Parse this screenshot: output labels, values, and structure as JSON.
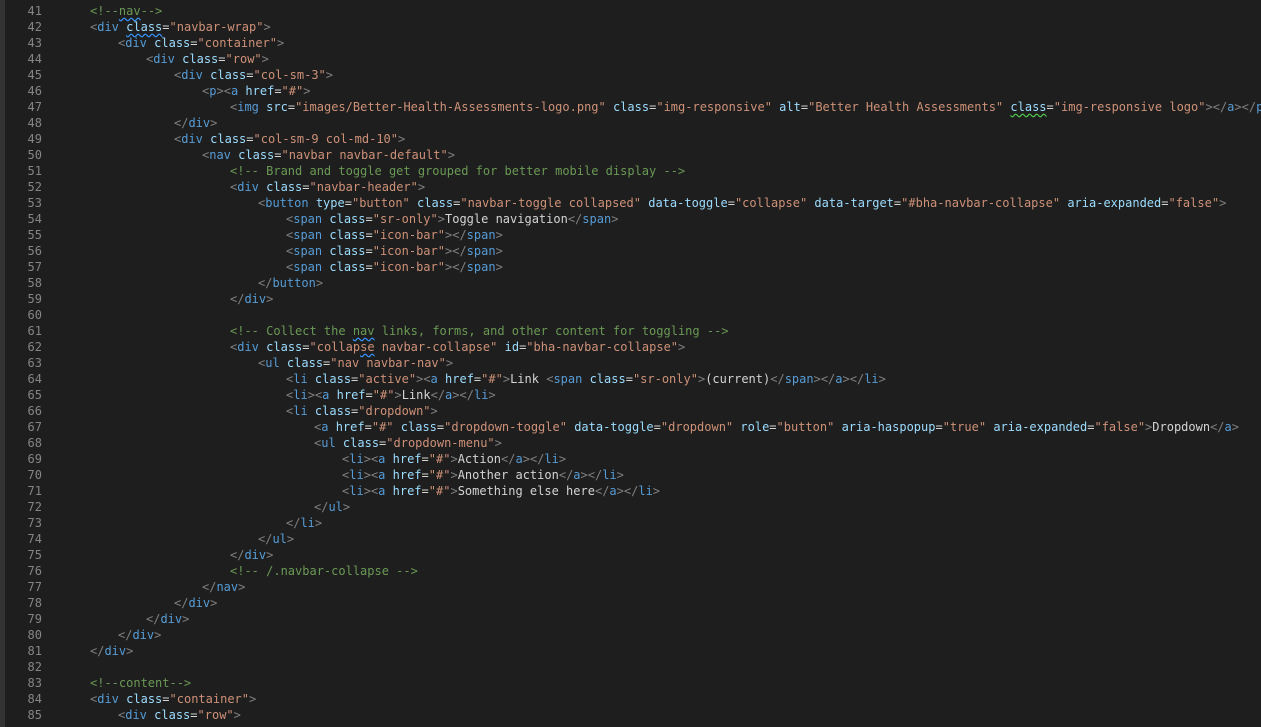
{
  "editor": {
    "line_numbers": [
      "41",
      "42",
      "43",
      "44",
      "45",
      "46",
      "47",
      "48",
      "49",
      "50",
      "51",
      "52",
      "53",
      "54",
      "55",
      "56",
      "57",
      "58",
      "59",
      "60",
      "61",
      "62",
      "63",
      "64",
      "65",
      "66",
      "67",
      "68",
      "69",
      "70",
      "71",
      "72",
      "73",
      "74",
      "75",
      "76",
      "77",
      "78",
      "79",
      "80",
      "81",
      "82",
      "83",
      "84",
      "85"
    ],
    "lines": [
      "<!--nav-->",
      "<div class=\"navbar-wrap\">",
      "<div class=\"container\">",
      "<div class=\"row\">",
      "<div class=\"col-sm-3\">",
      "<p><a href=\"#\">",
      "<img src=\"images/Better-Health-Assessments-logo.png\" class=\"img-responsive\" alt=\"Better Health Assessments\" class=\"img-responsive logo\"></a></p>",
      "</div>",
      "<div class=\"col-sm-9 col-md-10\">",
      "<nav class=\"navbar navbar-default\">",
      "<!-- Brand and toggle get grouped for better mobile display -->",
      "<div class=\"navbar-header\">",
      "<button type=\"button\" class=\"navbar-toggle collapsed\" data-toggle=\"collapse\" data-target=\"#bha-navbar-collapse\" aria-expanded=\"false\">",
      "<span class=\"sr-only\">Toggle navigation</span>",
      "<span class=\"icon-bar\"></span>",
      "<span class=\"icon-bar\"></span>",
      "<span class=\"icon-bar\"></span>",
      "</button>",
      "</div>",
      "",
      "<!-- Collect the nav links, forms, and other content for toggling -->",
      "<div class=\"collapse navbar-collapse\" id=\"bha-navbar-collapse\">",
      "<ul class=\"nav navbar-nav\">",
      "<li class=\"active\"><a href=\"#\">Link <span class=\"sr-only\">(current)</span></a></li>",
      "<li><a href=\"#\">Link</a></li>",
      "<li class=\"dropdown\">",
      "<a href=\"#\" class=\"dropdown-toggle\" data-toggle=\"dropdown\" role=\"button\" aria-haspopup=\"true\" aria-expanded=\"false\">Dropdown</a>",
      "<ul class=\"dropdown-menu\">",
      "<li><a href=\"#\">Action</a></li>",
      "<li><a href=\"#\">Another action</a></li>",
      "<li><a href=\"#\">Something else here</a></li>",
      "</ul>",
      "</li>",
      "</ul>",
      "</div>",
      "<!-- /.navbar-collapse -->",
      "</nav>",
      "</div>",
      "</div>",
      "</div>",
      "</div>",
      "",
      "<!--content-->",
      "<div class=\"container\">",
      "<div class=\"row\">"
    ]
  }
}
